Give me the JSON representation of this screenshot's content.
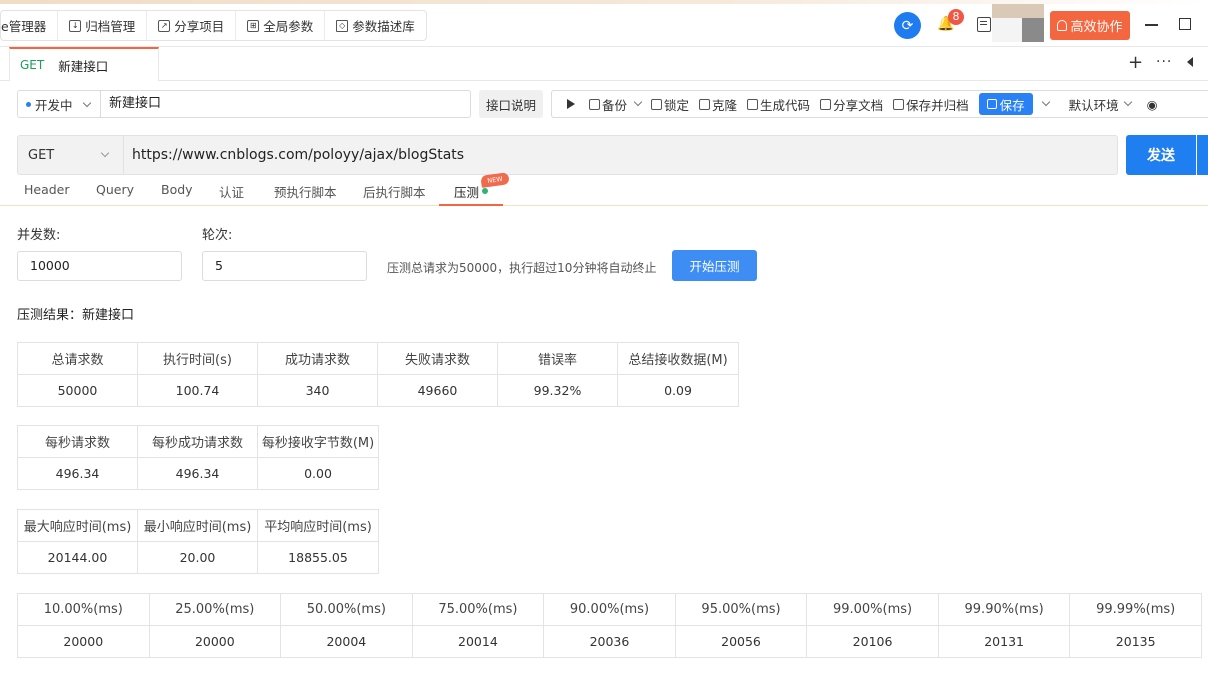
{
  "topbar": {
    "tabs": [
      {
        "label": "e管理器",
        "icon": "none"
      },
      {
        "label": "归档管理",
        "icon": "archive-icon"
      },
      {
        "label": "分享项目",
        "icon": "share-icon"
      },
      {
        "label": "全局参数",
        "icon": "params-icon"
      },
      {
        "label": "参数描述库",
        "icon": "cube-icon"
      }
    ],
    "notification_count": "8",
    "collab_label": "高效协作"
  },
  "doc_tab": {
    "method": "GET",
    "title": "新建接口"
  },
  "request_bar": {
    "status": "开发中",
    "name": "新建接口",
    "desc_label": "接口说明",
    "backup_label": "备份",
    "lock_label": "锁定",
    "clone_label": "克隆",
    "gencode_label": "生成代码",
    "share_doc_label": "分享文档",
    "save_archive_label": "保存并归档",
    "save_label": "保存",
    "env_label": "默认环境"
  },
  "url_bar": {
    "method": "GET",
    "url": "https://www.cnblogs.com/poloyy/ajax/blogStats",
    "send_label": "发送"
  },
  "param_tabs": [
    "Header",
    "Query",
    "Body",
    "认证",
    "预执行脚本",
    "后执行脚本",
    "压测"
  ],
  "new_badge": "NEW",
  "stress": {
    "concurrency_label": "并发数:",
    "concurrency_value": "10000",
    "rounds_label": "轮次:",
    "rounds_value": "5",
    "hint": "压测总请求为50000，执行超过10分钟将自动终止",
    "start_label": "开始压测",
    "result_title": "压测结果：新建接口"
  },
  "table1": {
    "headers": [
      "总请求数",
      "执行时间(s)",
      "成功请求数",
      "失败请求数",
      "错误率",
      "总结接收数据(M)"
    ],
    "values": [
      "50000",
      "100.74",
      "340",
      "49660",
      "99.32%",
      "0.09"
    ]
  },
  "table2": {
    "headers": [
      "每秒请求数",
      "每秒成功请求数",
      "每秒接收字节数(M)"
    ],
    "values": [
      "496.34",
      "496.34",
      "0.00"
    ]
  },
  "table3": {
    "headers": [
      "最大响应时间(ms)",
      "最小响应时间(ms)",
      "平均响应时间(ms)"
    ],
    "values": [
      "20144.00",
      "20.00",
      "18855.05"
    ]
  },
  "table4": {
    "headers": [
      "10.00%(ms)",
      "25.00%(ms)",
      "50.00%(ms)",
      "75.00%(ms)",
      "90.00%(ms)",
      "95.00%(ms)",
      "99.00%(ms)",
      "99.90%(ms)",
      "99.99%(ms)"
    ],
    "values": [
      "20000",
      "20000",
      "20004",
      "20014",
      "20036",
      "20056",
      "20106",
      "20131",
      "20135"
    ]
  }
}
